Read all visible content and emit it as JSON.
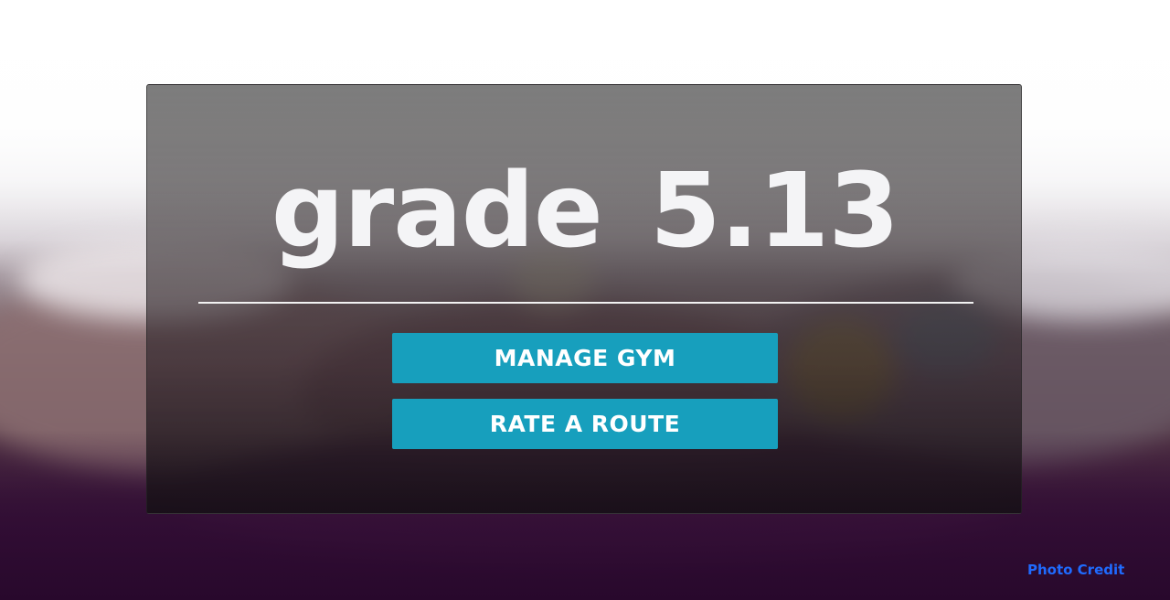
{
  "app": {
    "title": "grade 5.13"
  },
  "buttons": {
    "manage_gym": "MANAGE GYM",
    "rate_route": "RATE A ROUTE"
  },
  "footer": {
    "photo_credit": "Photo Credit"
  },
  "colors": {
    "button_background": "#179fbd",
    "button_text": "#ffffff",
    "title_text": "#f4f4f6",
    "divider": "#f2f2f2",
    "link": "#1f6bff",
    "background_bottom": "#2f0f32"
  }
}
